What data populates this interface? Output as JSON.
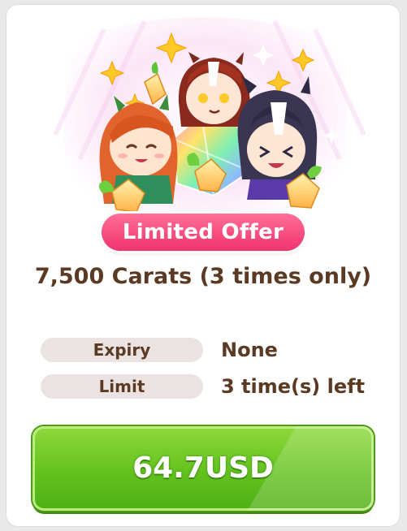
{
  "offer": {
    "badge_label": "Limited Offer",
    "title": "7,500 Carats (3 times only)",
    "art_icon": "carat-crystals-illustration"
  },
  "details": {
    "expiry_label": "Expiry",
    "expiry_value": "None",
    "limit_label": "Limit",
    "limit_value": "3 time(s) left"
  },
  "purchase": {
    "price_label": "64.7USD"
  },
  "colors": {
    "badge": "#f0336f",
    "text_brown": "#5b3a24",
    "button_green": "#63c21e",
    "pill_bg": "#ebe2e2"
  }
}
